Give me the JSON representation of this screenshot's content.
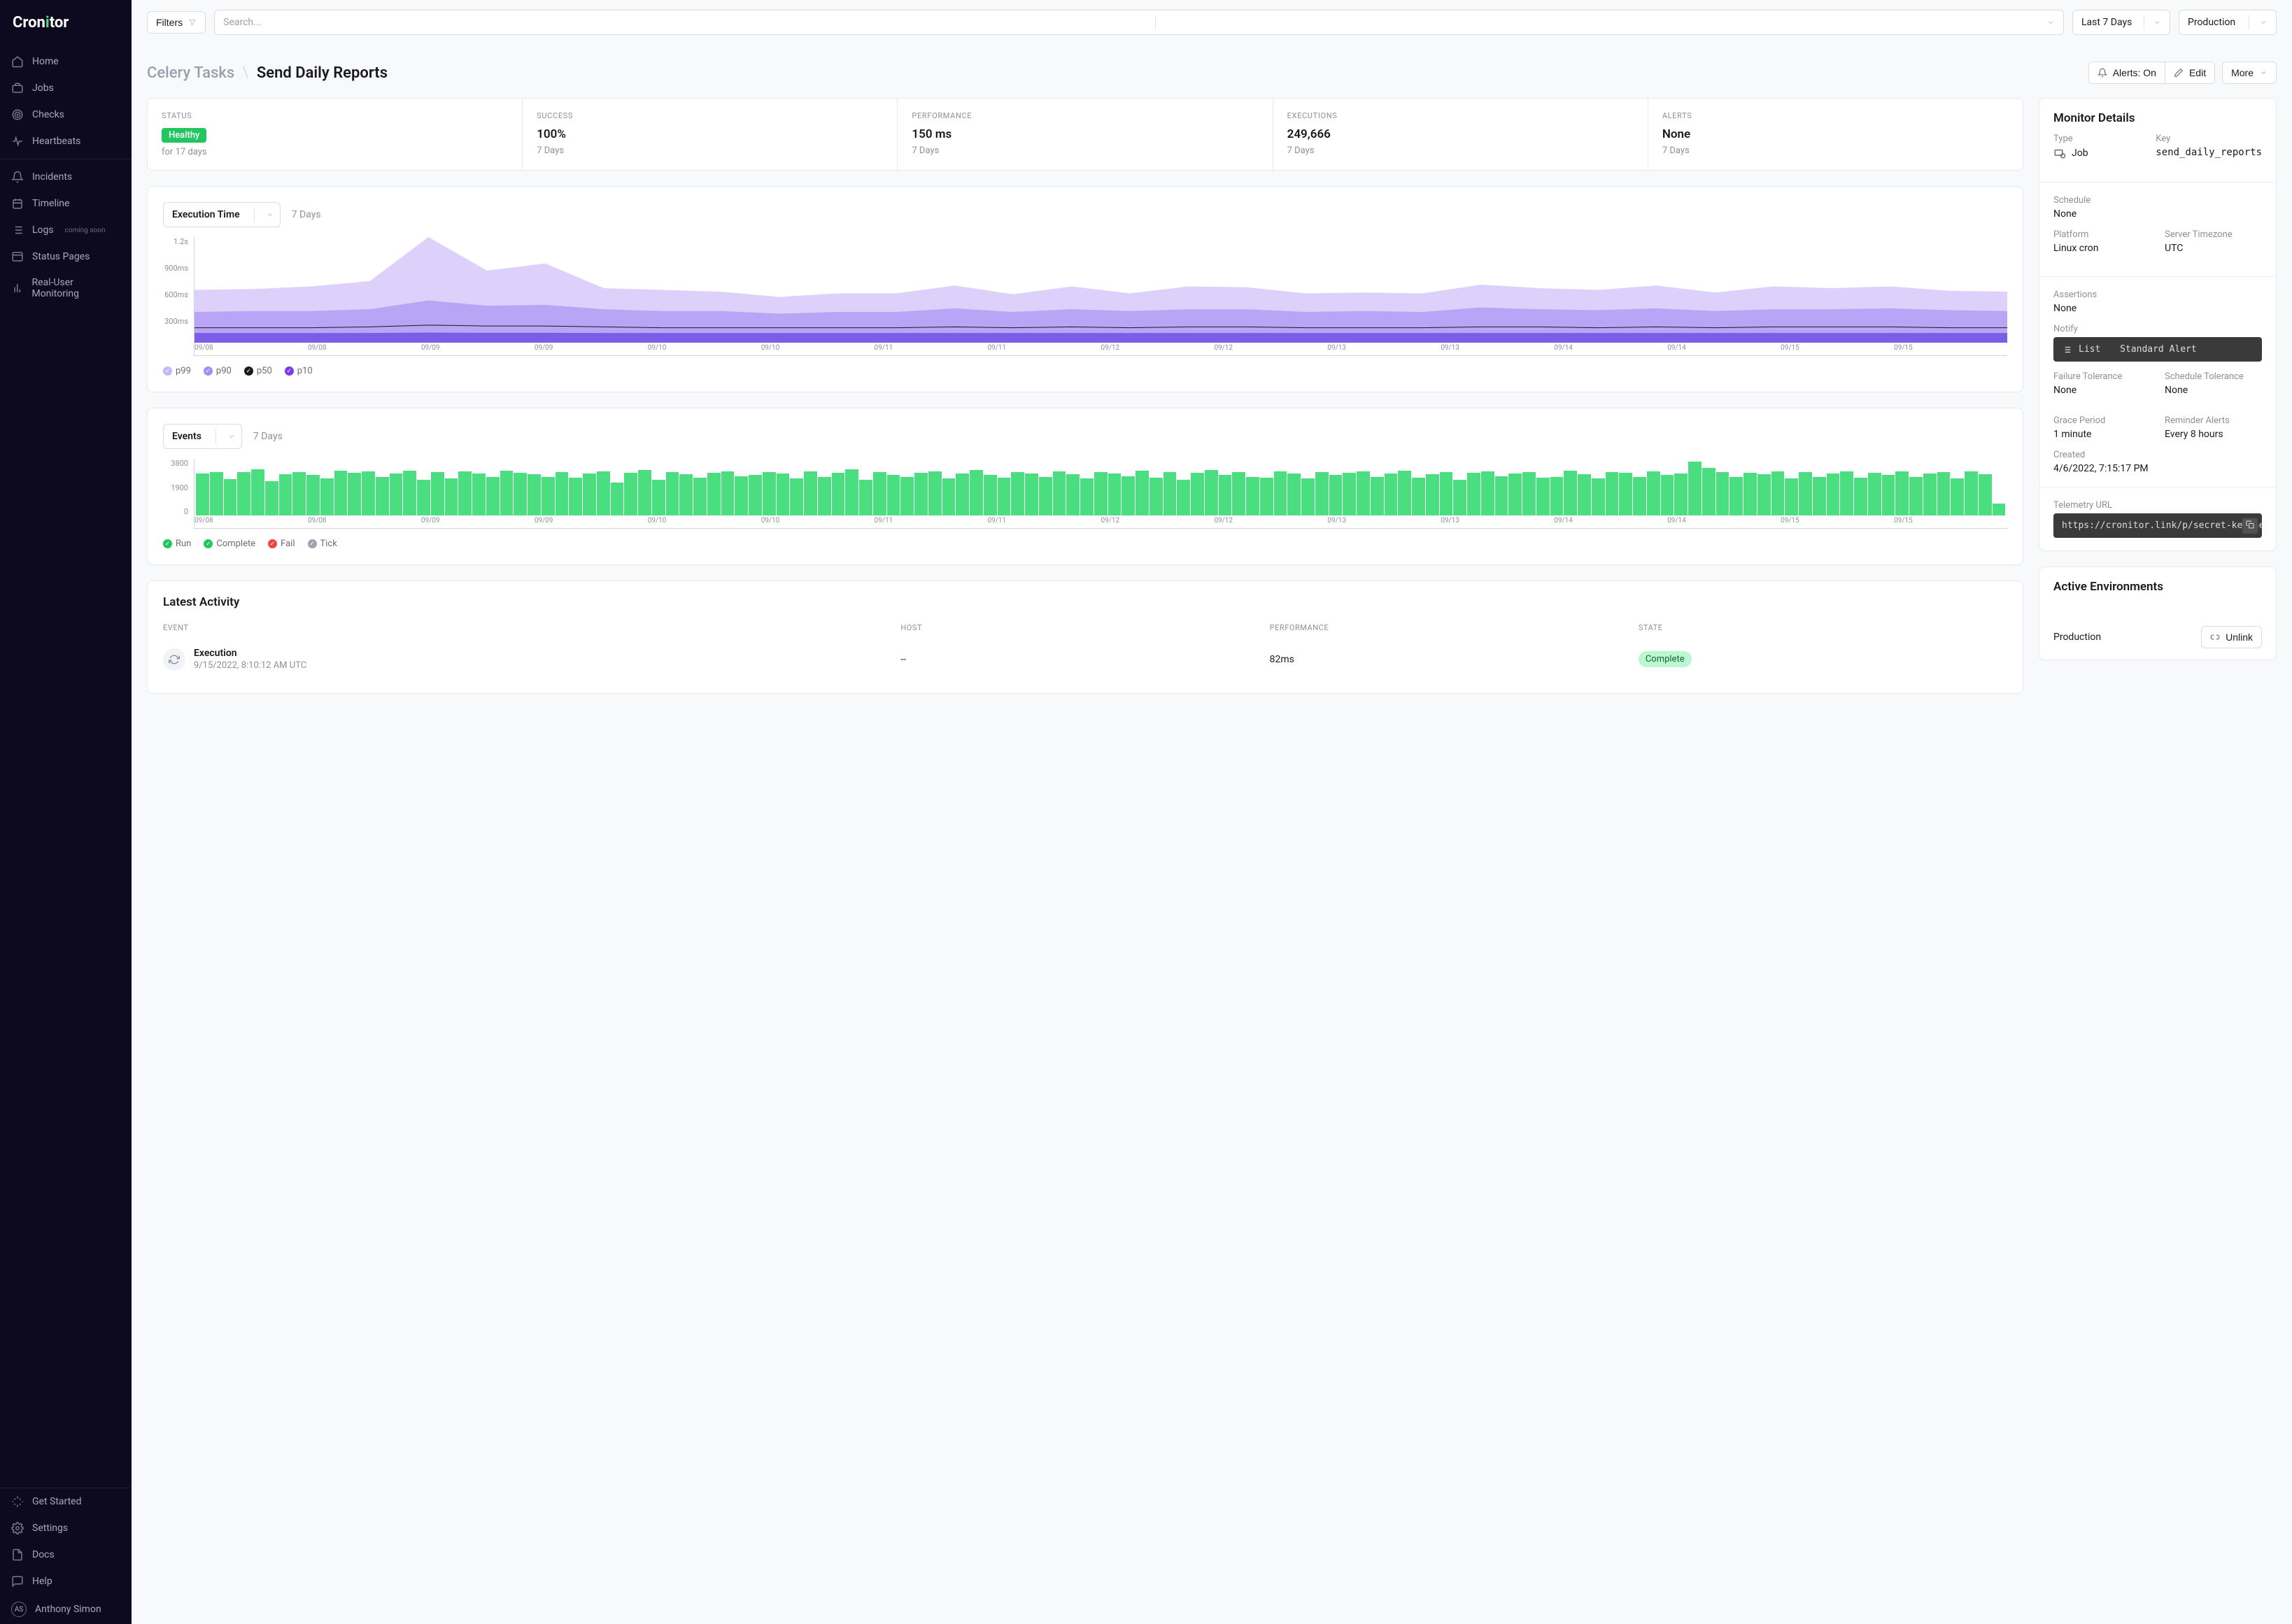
{
  "brand": "Cronitor",
  "nav": {
    "primary": [
      {
        "label": "Home",
        "icon": "home"
      },
      {
        "label": "Jobs",
        "icon": "briefcase"
      },
      {
        "label": "Checks",
        "icon": "target"
      },
      {
        "label": "Heartbeats",
        "icon": "pulse"
      }
    ],
    "secondary": [
      {
        "label": "Incidents",
        "icon": "bell"
      },
      {
        "label": "Timeline",
        "icon": "calendar"
      },
      {
        "label": "Logs",
        "icon": "list",
        "badge": "coming soon"
      },
      {
        "label": "Status Pages",
        "icon": "window"
      },
      {
        "label": "Real-User Monitoring",
        "icon": "barchart"
      }
    ],
    "footer": [
      {
        "label": "Get Started",
        "icon": "sparkle"
      },
      {
        "label": "Settings",
        "icon": "gear"
      },
      {
        "label": "Docs",
        "icon": "doc"
      },
      {
        "label": "Help",
        "icon": "chat"
      }
    ],
    "user": {
      "initials": "AS",
      "name": "Anthony Simon"
    }
  },
  "topbar": {
    "filters": "Filters",
    "search_placeholder": "Search...",
    "date_range": "Last 7 Days",
    "environment": "Production"
  },
  "breadcrumb": {
    "parent": "Celery Tasks",
    "current": "Send Daily Reports"
  },
  "page_actions": {
    "alerts": "Alerts: On",
    "edit": "Edit",
    "more": "More"
  },
  "stats": [
    {
      "label": "STATUS",
      "value": "Healthy",
      "meta": "for 17 days",
      "kind": "badge"
    },
    {
      "label": "SUCCESS",
      "value": "100%",
      "meta": "7 Days"
    },
    {
      "label": "PERFORMANCE",
      "value": "150 ms",
      "meta": "7 Days"
    },
    {
      "label": "EXECUTIONS",
      "value": "249,666",
      "meta": "7 Days"
    },
    {
      "label": "ALERTS",
      "value": "None",
      "meta": "7 Days"
    }
  ],
  "chart_data": [
    {
      "type": "area",
      "title": "Execution Time",
      "range": "7 Days",
      "ylabel": "ms",
      "y_ticks": [
        "1.2s",
        "900ms",
        "600ms",
        "300ms",
        ""
      ],
      "ylim": [
        0,
        1200
      ],
      "x_categories": [
        "09/08",
        "09/08",
        "09/09",
        "09/09",
        "09/10",
        "09/10",
        "09/11",
        "09/11",
        "09/12",
        "09/12",
        "09/13",
        "09/13",
        "09/14",
        "09/14",
        "09/15",
        "09/15"
      ],
      "series": [
        {
          "name": "p99",
          "color": "#c4b5fd",
          "values": [
            600,
            610,
            640,
            700,
            1200,
            820,
            900,
            620,
            600,
            580,
            520,
            560,
            560,
            650,
            550,
            640,
            560,
            640,
            630,
            560,
            570,
            560,
            660,
            620,
            600,
            650,
            570,
            640,
            620,
            640,
            590,
            580
          ]
        },
        {
          "name": "p90",
          "color": "#a78bfa",
          "values": [
            350,
            360,
            360,
            380,
            480,
            420,
            430,
            380,
            360,
            360,
            330,
            350,
            350,
            390,
            350,
            380,
            360,
            380,
            380,
            350,
            360,
            350,
            400,
            380,
            370,
            390,
            360,
            380,
            380,
            390,
            370,
            360
          ]
        },
        {
          "name": "p50",
          "color": "#1a1a1a",
          "values": [
            170,
            170,
            170,
            180,
            200,
            190,
            190,
            180,
            170,
            170,
            170,
            170,
            170,
            180,
            170,
            180,
            170,
            180,
            180,
            170,
            170,
            170,
            180,
            180,
            170,
            180,
            170,
            180,
            180,
            180,
            170,
            170
          ]
        },
        {
          "name": "p10",
          "color": "#7c3aed",
          "values": [
            110,
            110,
            110,
            110,
            115,
            112,
            112,
            110,
            110,
            110,
            110,
            110,
            110,
            110,
            110,
            110,
            110,
            110,
            110,
            110,
            110,
            110,
            110,
            110,
            110,
            110,
            110,
            110,
            110,
            110,
            110,
            110
          ]
        }
      ],
      "legend": [
        {
          "label": "p99",
          "color": "#c4b5fd"
        },
        {
          "label": "p90",
          "color": "#a78bfa"
        },
        {
          "label": "p50",
          "color": "#1a1a1a"
        },
        {
          "label": "p10",
          "color": "#7c3aed"
        }
      ]
    },
    {
      "type": "bar",
      "title": "Events",
      "range": "7 Days",
      "ylabel": "",
      "y_ticks": [
        "3800",
        "1900",
        "0"
      ],
      "ylim": [
        0,
        3800
      ],
      "x_categories": [
        "09/08",
        "09/08",
        "09/09",
        "09/09",
        "09/10",
        "09/10",
        "09/11",
        "09/11",
        "09/12",
        "09/12",
        "09/13",
        "09/13",
        "09/14",
        "09/14",
        "09/15",
        "09/15"
      ],
      "series": [
        {
          "name": "Run",
          "color": "#22c55e",
          "values": [
            2800,
            2900,
            2450,
            2900,
            3100,
            2300,
            2750,
            2900,
            2700,
            2500,
            3000,
            2850,
            2950,
            2600,
            2800,
            3000,
            2400,
            2900,
            2500,
            2950,
            2800,
            2600,
            3000,
            2850,
            2750,
            2600,
            2900,
            2550,
            2800,
            2950,
            2200,
            2850,
            3050,
            2400,
            2900,
            2750,
            2550,
            2850,
            2950,
            2650,
            2700,
            2900,
            2800,
            2500,
            2950,
            2600,
            2850,
            3100,
            2400,
            2900,
            2700,
            2600,
            2850,
            2950,
            2500,
            2800,
            3050,
            2700,
            2550,
            2900,
            2800,
            2600,
            2950,
            2750,
            2500,
            2900,
            2800,
            2650,
            3000,
            2550,
            2900,
            2400,
            2850,
            3050,
            2700,
            2900,
            2600,
            2550,
            2950,
            2800,
            2500,
            2900,
            2700,
            2850,
            2950,
            2600,
            2800,
            3000,
            2550,
            2750,
            2900,
            2400,
            2850,
            2950,
            2650,
            2800,
            2900,
            2550,
            2600,
            3000,
            2750,
            2500,
            2900,
            2850,
            2600,
            2950,
            2700,
            2800,
            3600,
            3200,
            2900,
            2600,
            2850,
            2750,
            2950,
            2500,
            2900,
            2600,
            2800,
            2950,
            2550,
            2850,
            2700,
            2950,
            2600,
            2800,
            2900,
            2500,
            2950,
            2750,
            800
          ]
        }
      ],
      "legend": [
        {
          "label": "Run",
          "color": "#22c55e"
        },
        {
          "label": "Complete",
          "color": "#22c55e"
        },
        {
          "label": "Fail",
          "color": "#ef4444"
        },
        {
          "label": "Tick",
          "color": "#9ca3af"
        }
      ]
    }
  ],
  "activity": {
    "title": "Latest Activity",
    "columns": {
      "event": "EVENT",
      "host": "HOST",
      "performance": "PERFORMANCE",
      "state": "STATE"
    },
    "rows": [
      {
        "event": "Execution",
        "time": "9/15/2022, 8:10:12 AM UTC",
        "host": "--",
        "performance": "82ms",
        "state": "Complete"
      }
    ]
  },
  "details": {
    "title": "Monitor Details",
    "type_label": "Type",
    "type_value": "Job",
    "key_label": "Key",
    "key_value": "send_daily_reports",
    "schedule_label": "Schedule",
    "schedule_value": "None",
    "platform_label": "Platform",
    "platform_value": "Linux cron",
    "tz_label": "Server Timezone",
    "tz_value": "UTC",
    "assertions_label": "Assertions",
    "assertions_value": "None",
    "notify_label": "Notify",
    "notify_list_label": "List",
    "notify_value": "Standard Alert",
    "failtol_label": "Failure Tolerance",
    "failtol_value": "None",
    "schedtol_label": "Schedule Tolerance",
    "schedtol_value": "None",
    "grace_label": "Grace Period",
    "grace_value": "1 minute",
    "reminder_label": "Reminder Alerts",
    "reminder_value": "Every 8 hours",
    "created_label": "Created",
    "created_value": "4/6/2022, 7:15:17 PM",
    "telemetry_label": "Telemetry URL",
    "telemetry_value": "https://cronitor.link/p/secret-key/send_daily_"
  },
  "environments": {
    "title": "Active Environments",
    "rows": [
      {
        "name": "Production",
        "action": "Unlink"
      }
    ]
  }
}
